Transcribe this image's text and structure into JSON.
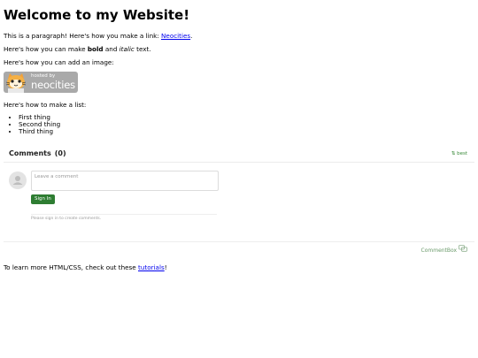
{
  "heading": "Welcome to my Website!",
  "para1": {
    "text": "This is a paragraph! Here's how you make a link: ",
    "link": "Neocities",
    "end": "."
  },
  "para2": {
    "pre": "Here's how you can make ",
    "bold": "bold",
    "mid": " and ",
    "italic": "italic",
    "end": " text."
  },
  "para3": "Here's how you can add an image:",
  "badge": {
    "hosted": "hosted by",
    "brand": "neocities"
  },
  "list_intro": "Here's how to make a list:",
  "list": [
    "First thing",
    "Second thing",
    "Third thing"
  ],
  "comments": {
    "title": "Comments",
    "count": "(0)",
    "sort": "best",
    "placeholder": "Leave a comment",
    "sign_in": "Sign In",
    "note": "Please sign in to create comments.",
    "footer": "CommentBox"
  },
  "learn": {
    "text": "To learn more HTML/CSS, check out these ",
    "link": "tutorials",
    "end": "!"
  },
  "colors": {
    "link": "#0000ee",
    "signin": "#2e7d32"
  }
}
